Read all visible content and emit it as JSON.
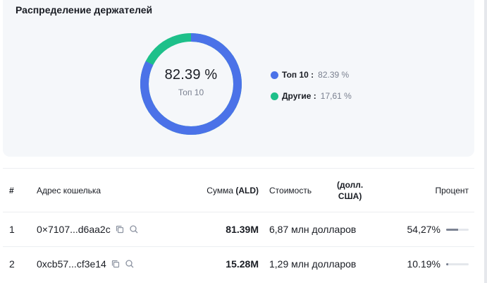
{
  "card": {
    "title": "Распределение держателей",
    "center_value": "82.39 %",
    "center_label": "Топ 10",
    "top_fraction": 0.8239,
    "legend": [
      {
        "label": "Топ 10 :",
        "value": "82.39 %",
        "color": "#4b72e8"
      },
      {
        "label": "Другие :",
        "value": "17,61 %",
        "color": "#1ec08a"
      }
    ]
  },
  "table": {
    "headers": {
      "num": "#",
      "address": "Адрес кошелька",
      "sum_prefix": "Сумма",
      "sum_unit": "(ALD)",
      "value": "Стоимость",
      "usd_line1": "(долл.",
      "usd_line2": "США)",
      "percent": "Процент"
    },
    "rows": [
      {
        "num": "1",
        "address": "0×7107...d6aa2c",
        "sum": "81.39M",
        "value": "6,87 млн долларов",
        "percent": "54,27%",
        "share": 0.5427
      },
      {
        "num": "2",
        "address": "0xcb57...cf3e14",
        "sum": "15.28M",
        "value": "1,29 млн долларов",
        "percent": "10.19%",
        "share": 0.1019
      }
    ]
  }
}
